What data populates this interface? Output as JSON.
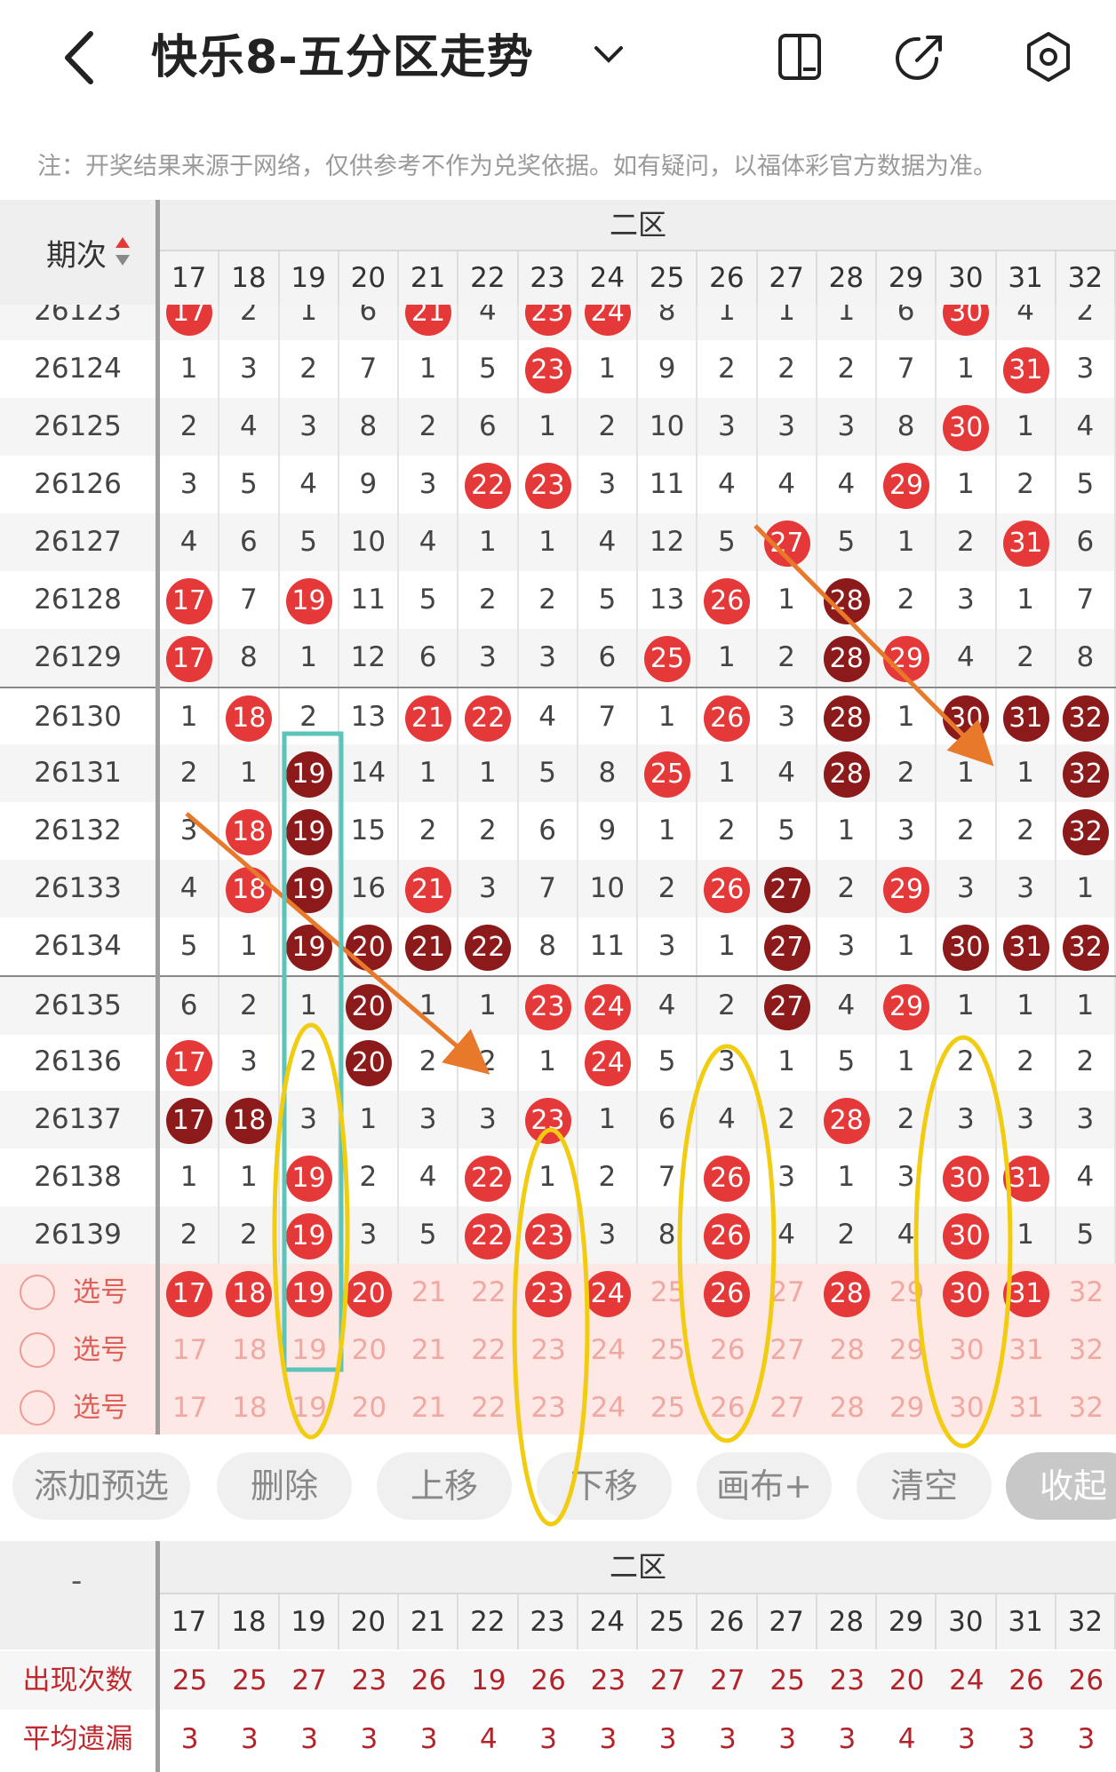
{
  "header": {
    "title": "快乐8-五分区走势",
    "back_icon": "chevron-left-icon",
    "dropdown_icon": "chevron-down-icon",
    "icons": [
      "phone-layout-icon",
      "share-icon",
      "settings-icon"
    ]
  },
  "note": "注：开奖结果来源于网络，仅供参考不作为兑奖依据。如有疑问，以福体彩官方数据为准。",
  "grid": {
    "period_header": "期次",
    "zone_label": "二区",
    "columns": [
      "17",
      "18",
      "19",
      "20",
      "21",
      "22",
      "23",
      "24",
      "25",
      "26",
      "27",
      "28",
      "29",
      "30",
      "31",
      "32"
    ],
    "rows": [
      {
        "period": "26123",
        "cells": [
          [
            "17",
            "r"
          ],
          [
            "2",
            ""
          ],
          [
            "1",
            ""
          ],
          [
            "6",
            ""
          ],
          [
            "21",
            "r"
          ],
          [
            "4",
            ""
          ],
          [
            "23",
            "r"
          ],
          [
            "24",
            "r"
          ],
          [
            "8",
            ""
          ],
          [
            "1",
            ""
          ],
          [
            "1",
            ""
          ],
          [
            "1",
            ""
          ],
          [
            "6",
            ""
          ],
          [
            "30",
            "r"
          ],
          [
            "4",
            ""
          ],
          [
            "2",
            ""
          ]
        ]
      },
      {
        "period": "26124",
        "cells": [
          [
            "1",
            ""
          ],
          [
            "3",
            ""
          ],
          [
            "2",
            ""
          ],
          [
            "7",
            ""
          ],
          [
            "1",
            ""
          ],
          [
            "5",
            ""
          ],
          [
            "23",
            "r"
          ],
          [
            "1",
            ""
          ],
          [
            "9",
            ""
          ],
          [
            "2",
            ""
          ],
          [
            "2",
            ""
          ],
          [
            "2",
            ""
          ],
          [
            "7",
            ""
          ],
          [
            "1",
            ""
          ],
          [
            "31",
            "r"
          ],
          [
            "3",
            ""
          ]
        ]
      },
      {
        "period": "26125",
        "cells": [
          [
            "2",
            ""
          ],
          [
            "4",
            ""
          ],
          [
            "3",
            ""
          ],
          [
            "8",
            ""
          ],
          [
            "2",
            ""
          ],
          [
            "6",
            ""
          ],
          [
            "1",
            ""
          ],
          [
            "2",
            ""
          ],
          [
            "10",
            ""
          ],
          [
            "3",
            ""
          ],
          [
            "3",
            ""
          ],
          [
            "3",
            ""
          ],
          [
            "8",
            ""
          ],
          [
            "30",
            "r"
          ],
          [
            "1",
            ""
          ],
          [
            "4",
            ""
          ]
        ]
      },
      {
        "period": "26126",
        "cells": [
          [
            "3",
            ""
          ],
          [
            "5",
            ""
          ],
          [
            "4",
            ""
          ],
          [
            "9",
            ""
          ],
          [
            "3",
            ""
          ],
          [
            "22",
            "r"
          ],
          [
            "23",
            "r"
          ],
          [
            "3",
            ""
          ],
          [
            "11",
            ""
          ],
          [
            "4",
            ""
          ],
          [
            "4",
            ""
          ],
          [
            "4",
            ""
          ],
          [
            "29",
            "r"
          ],
          [
            "1",
            ""
          ],
          [
            "2",
            ""
          ],
          [
            "5",
            ""
          ]
        ]
      },
      {
        "period": "26127",
        "cells": [
          [
            "4",
            ""
          ],
          [
            "6",
            ""
          ],
          [
            "5",
            ""
          ],
          [
            "10",
            ""
          ],
          [
            "4",
            ""
          ],
          [
            "1",
            ""
          ],
          [
            "1",
            ""
          ],
          [
            "4",
            ""
          ],
          [
            "12",
            ""
          ],
          [
            "5",
            ""
          ],
          [
            "27",
            "r"
          ],
          [
            "5",
            ""
          ],
          [
            "1",
            ""
          ],
          [
            "2",
            ""
          ],
          [
            "31",
            "r"
          ],
          [
            "6",
            ""
          ]
        ]
      },
      {
        "period": "26128",
        "cells": [
          [
            "17",
            "r"
          ],
          [
            "7",
            ""
          ],
          [
            "19",
            "r"
          ],
          [
            "11",
            ""
          ],
          [
            "5",
            ""
          ],
          [
            "2",
            ""
          ],
          [
            "2",
            ""
          ],
          [
            "5",
            ""
          ],
          [
            "13",
            ""
          ],
          [
            "26",
            "r"
          ],
          [
            "1",
            ""
          ],
          [
            "28",
            "d"
          ],
          [
            "2",
            ""
          ],
          [
            "3",
            ""
          ],
          [
            "1",
            ""
          ],
          [
            "7",
            ""
          ]
        ]
      },
      {
        "period": "26129",
        "cells": [
          [
            "17",
            "r"
          ],
          [
            "8",
            ""
          ],
          [
            "1",
            ""
          ],
          [
            "12",
            ""
          ],
          [
            "6",
            ""
          ],
          [
            "3",
            ""
          ],
          [
            "3",
            ""
          ],
          [
            "6",
            ""
          ],
          [
            "25",
            "r"
          ],
          [
            "1",
            ""
          ],
          [
            "2",
            ""
          ],
          [
            "28",
            "d"
          ],
          [
            "29",
            "r"
          ],
          [
            "4",
            ""
          ],
          [
            "2",
            ""
          ],
          [
            "8",
            ""
          ]
        ]
      },
      {
        "period": "26130",
        "cells": [
          [
            "1",
            ""
          ],
          [
            "18",
            "r"
          ],
          [
            "2",
            ""
          ],
          [
            "13",
            ""
          ],
          [
            "21",
            "r"
          ],
          [
            "22",
            "r"
          ],
          [
            "4",
            ""
          ],
          [
            "7",
            ""
          ],
          [
            "1",
            ""
          ],
          [
            "26",
            "r"
          ],
          [
            "3",
            ""
          ],
          [
            "28",
            "d"
          ],
          [
            "1",
            ""
          ],
          [
            "30",
            "d"
          ],
          [
            "31",
            "d"
          ],
          [
            "32",
            "d"
          ]
        ]
      },
      {
        "period": "26131",
        "cells": [
          [
            "2",
            ""
          ],
          [
            "1",
            ""
          ],
          [
            "19",
            "d"
          ],
          [
            "14",
            ""
          ],
          [
            "1",
            ""
          ],
          [
            "1",
            ""
          ],
          [
            "5",
            ""
          ],
          [
            "8",
            ""
          ],
          [
            "25",
            "r"
          ],
          [
            "1",
            ""
          ],
          [
            "4",
            ""
          ],
          [
            "28",
            "d"
          ],
          [
            "2",
            ""
          ],
          [
            "1",
            ""
          ],
          [
            "1",
            ""
          ],
          [
            "32",
            "d"
          ]
        ]
      },
      {
        "period": "26132",
        "cells": [
          [
            "3",
            ""
          ],
          [
            "18",
            "r"
          ],
          [
            "19",
            "d"
          ],
          [
            "15",
            ""
          ],
          [
            "2",
            ""
          ],
          [
            "2",
            ""
          ],
          [
            "6",
            ""
          ],
          [
            "9",
            ""
          ],
          [
            "1",
            ""
          ],
          [
            "2",
            ""
          ],
          [
            "5",
            ""
          ],
          [
            "1",
            ""
          ],
          [
            "3",
            ""
          ],
          [
            "2",
            ""
          ],
          [
            "2",
            ""
          ],
          [
            "32",
            "d"
          ]
        ]
      },
      {
        "period": "26133",
        "cells": [
          [
            "4",
            ""
          ],
          [
            "18",
            "r"
          ],
          [
            "19",
            "d"
          ],
          [
            "16",
            ""
          ],
          [
            "21",
            "r"
          ],
          [
            "3",
            ""
          ],
          [
            "7",
            ""
          ],
          [
            "10",
            ""
          ],
          [
            "2",
            ""
          ],
          [
            "26",
            "r"
          ],
          [
            "27",
            "d"
          ],
          [
            "2",
            ""
          ],
          [
            "29",
            "r"
          ],
          [
            "3",
            ""
          ],
          [
            "3",
            ""
          ],
          [
            "1",
            ""
          ]
        ]
      },
      {
        "period": "26134",
        "cells": [
          [
            "5",
            ""
          ],
          [
            "1",
            ""
          ],
          [
            "19",
            "d"
          ],
          [
            "20",
            "d"
          ],
          [
            "21",
            "d"
          ],
          [
            "22",
            "d"
          ],
          [
            "8",
            ""
          ],
          [
            "11",
            ""
          ],
          [
            "3",
            ""
          ],
          [
            "1",
            ""
          ],
          [
            "27",
            "d"
          ],
          [
            "3",
            ""
          ],
          [
            "1",
            ""
          ],
          [
            "30",
            "d"
          ],
          [
            "31",
            "d"
          ],
          [
            "32",
            "d"
          ]
        ]
      },
      {
        "period": "26135",
        "cells": [
          [
            "6",
            ""
          ],
          [
            "2",
            ""
          ],
          [
            "1",
            ""
          ],
          [
            "20",
            "d"
          ],
          [
            "1",
            ""
          ],
          [
            "1",
            ""
          ],
          [
            "23",
            "r"
          ],
          [
            "24",
            "r"
          ],
          [
            "4",
            ""
          ],
          [
            "2",
            ""
          ],
          [
            "27",
            "d"
          ],
          [
            "4",
            ""
          ],
          [
            "29",
            "r"
          ],
          [
            "1",
            ""
          ],
          [
            "1",
            ""
          ],
          [
            "1",
            ""
          ]
        ]
      },
      {
        "period": "26136",
        "cells": [
          [
            "17",
            "r"
          ],
          [
            "3",
            ""
          ],
          [
            "2",
            ""
          ],
          [
            "20",
            "d"
          ],
          [
            "2",
            ""
          ],
          [
            "2",
            ""
          ],
          [
            "1",
            ""
          ],
          [
            "24",
            "r"
          ],
          [
            "5",
            ""
          ],
          [
            "3",
            ""
          ],
          [
            "1",
            ""
          ],
          [
            "5",
            ""
          ],
          [
            "1",
            ""
          ],
          [
            "2",
            ""
          ],
          [
            "2",
            ""
          ],
          [
            "2",
            ""
          ]
        ]
      },
      {
        "period": "26137",
        "cells": [
          [
            "17",
            "d"
          ],
          [
            "18",
            "d"
          ],
          [
            "3",
            ""
          ],
          [
            "1",
            ""
          ],
          [
            "3",
            ""
          ],
          [
            "3",
            ""
          ],
          [
            "23",
            "r"
          ],
          [
            "1",
            ""
          ],
          [
            "6",
            ""
          ],
          [
            "4",
            ""
          ],
          [
            "2",
            ""
          ],
          [
            "28",
            "r"
          ],
          [
            "2",
            ""
          ],
          [
            "3",
            ""
          ],
          [
            "3",
            ""
          ],
          [
            "3",
            ""
          ]
        ]
      },
      {
        "period": "26138",
        "cells": [
          [
            "1",
            ""
          ],
          [
            "1",
            ""
          ],
          [
            "19",
            "r"
          ],
          [
            "2",
            ""
          ],
          [
            "4",
            ""
          ],
          [
            "22",
            "r"
          ],
          [
            "1",
            ""
          ],
          [
            "2",
            ""
          ],
          [
            "7",
            ""
          ],
          [
            "26",
            "r"
          ],
          [
            "3",
            ""
          ],
          [
            "1",
            ""
          ],
          [
            "3",
            ""
          ],
          [
            "30",
            "r"
          ],
          [
            "31",
            "r"
          ],
          [
            "4",
            ""
          ]
        ]
      },
      {
        "period": "26139",
        "cells": [
          [
            "2",
            ""
          ],
          [
            "2",
            ""
          ],
          [
            "19",
            "r"
          ],
          [
            "3",
            ""
          ],
          [
            "5",
            ""
          ],
          [
            "22",
            "r"
          ],
          [
            "23",
            "r"
          ],
          [
            "3",
            ""
          ],
          [
            "8",
            ""
          ],
          [
            "26",
            "r"
          ],
          [
            "4",
            ""
          ],
          [
            "2",
            ""
          ],
          [
            "4",
            ""
          ],
          [
            "30",
            "r"
          ],
          [
            "1",
            ""
          ],
          [
            "5",
            ""
          ]
        ]
      }
    ],
    "select_label": "选号",
    "select_rows": [
      [
        "17",
        "18",
        "19",
        "20",
        "",
        "",
        "23",
        "24",
        "",
        "26",
        "",
        "28",
        "",
        "30",
        "31",
        ""
      ],
      [
        "",
        "",
        "",
        "",
        "",
        "",
        "",
        "",
        "",
        "",
        "",
        "",
        "",
        "",
        "",
        ""
      ],
      [
        "",
        "",
        "",
        "",
        "",
        "",
        "",
        "",
        "",
        "",
        "",
        "",
        "",
        "",
        "",
        ""
      ]
    ]
  },
  "buttons": [
    "添加预选",
    "删除",
    "上移",
    "下移",
    "画布+",
    "清空",
    "收起"
  ],
  "stats": {
    "corner": "-",
    "zone_label": "二区",
    "columns": [
      "17",
      "18",
      "19",
      "20",
      "21",
      "22",
      "23",
      "24",
      "25",
      "26",
      "27",
      "28",
      "29",
      "30",
      "31",
      "32"
    ],
    "rows": [
      {
        "label": "出现次数",
        "values": [
          "25",
          "25",
          "27",
          "23",
          "26",
          "19",
          "26",
          "23",
          "27",
          "27",
          "25",
          "23",
          "20",
          "24",
          "26",
          "26"
        ]
      },
      {
        "label": "平均遗漏",
        "values": [
          "3",
          "3",
          "3",
          "3",
          "3",
          "4",
          "3",
          "3",
          "3",
          "3",
          "3",
          "3",
          "4",
          "3",
          "3",
          "3"
        ]
      }
    ]
  },
  "colors": {
    "red": "#e53939",
    "dark": "#8c1a1a",
    "annotation_orange": "#e8782a",
    "annotation_yellow": "#f2cc10",
    "annotation_teal": "#5cc4b8"
  }
}
